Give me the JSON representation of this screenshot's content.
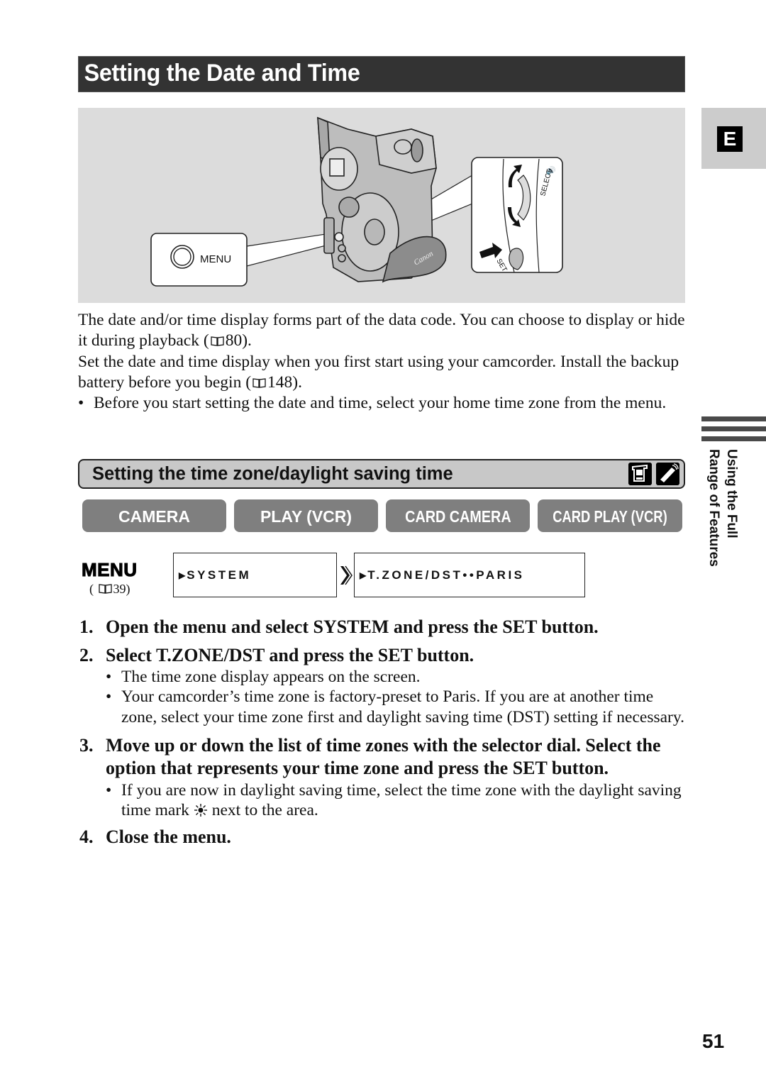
{
  "page": {
    "title": "Setting the Date and Time",
    "language_tab": "E",
    "page_number": "51",
    "side_section": [
      "Using the Full",
      "Range of Features"
    ]
  },
  "illustration": {
    "menu_callout": "MENU",
    "select_label": "SELECT",
    "set_label": "SET",
    "brand_on_strap": "Canon"
  },
  "intro": {
    "p1_a": "The date and/or time display forms part of the data code. You can choose to display or hide it during playback (",
    "p1_ref": "80",
    "p1_b": ").",
    "p2_a": "Set the date and time display when you first start using your camcorder. Install the backup battery before you begin (",
    "p2_ref": "148",
    "p2_b": ").",
    "bullet": "Before you start setting the date and time, select your home time zone from the menu."
  },
  "section": {
    "title": "Setting the time zone/daylight saving time",
    "icons": [
      "camcorder-icon",
      "remote-control-icon"
    ]
  },
  "modes": [
    {
      "label": "CAMERA"
    },
    {
      "label": "PLAY (VCR)"
    },
    {
      "label": "CARD CAMERA"
    },
    {
      "label": "CARD PLAY (VCR)"
    }
  ],
  "menu_path": {
    "label": "MENU",
    "ref_page": "39",
    "step1": "SYSTEM",
    "step2": "T.ZONE/DST••PARIS"
  },
  "steps": [
    {
      "num": "1.",
      "text": "Open the menu and select SYSTEM and press the SET button.",
      "bullets": []
    },
    {
      "num": "2.",
      "text": "Select T.ZONE/DST and press the SET button.",
      "bullets": [
        "The time zone display appears on the screen.",
        "Your camcorder’s time zone is factory-preset to Paris. If you are at another time zone, select your time zone first and daylight saving time (DST) setting if necessary."
      ]
    },
    {
      "num": "3.",
      "text": "Move up or down the list of time zones with the selector dial. Select the option that represents your time zone and press the SET button.",
      "bullets": []
    },
    {
      "num": "4.",
      "text": "Close the menu.",
      "bullets": []
    }
  ],
  "step3_bullet": {
    "a": "If you are now in daylight saving time, select the time zone with the daylight saving time mark",
    "b": "next to the area."
  },
  "bullet_char": "•"
}
